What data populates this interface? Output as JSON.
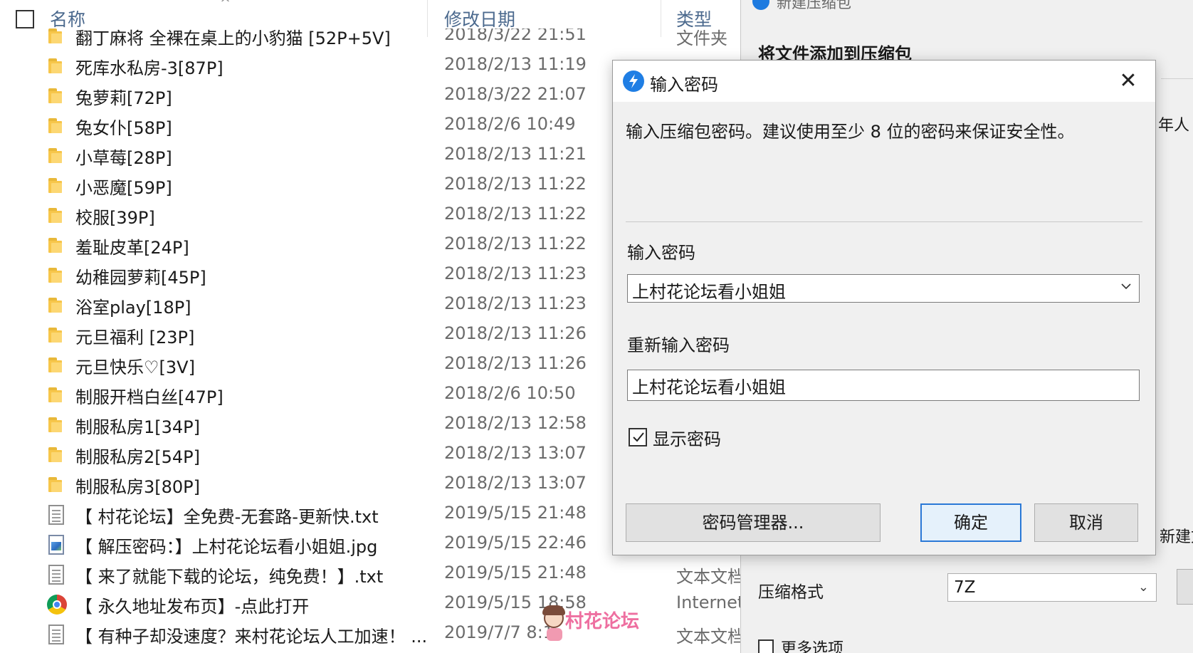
{
  "explorer": {
    "columns": {
      "name": "名称",
      "date": "修改日期",
      "type": "类型"
    },
    "rows": [
      {
        "icon": "folder-icon",
        "name": "翻丁麻将 全裸在桌上的小豹猫 [52P+5V]",
        "date": "2018/3/22 21:51",
        "type": "文件夹"
      },
      {
        "icon": "folder-icon",
        "name": "死库水私房-3[87P]",
        "date": "2018/2/13 11:19",
        "type": ""
      },
      {
        "icon": "folder-icon",
        "name": "兔萝莉[72P]",
        "date": "2018/3/22 21:07",
        "type": ""
      },
      {
        "icon": "folder-icon",
        "name": "兔女仆[58P]",
        "date": "2018/2/6 10:49",
        "type": ""
      },
      {
        "icon": "folder-icon",
        "name": "小草莓[28P]",
        "date": "2018/2/13 11:21",
        "type": ""
      },
      {
        "icon": "folder-icon",
        "name": "小恶魔[59P]",
        "date": "2018/2/13 11:22",
        "type": ""
      },
      {
        "icon": "folder-icon",
        "name": "校服[39P]",
        "date": "2018/2/13 11:22",
        "type": ""
      },
      {
        "icon": "folder-icon",
        "name": "羞耻皮革[24P]",
        "date": "2018/2/13 11:22",
        "type": ""
      },
      {
        "icon": "folder-icon",
        "name": "幼稚园萝莉[45P]",
        "date": "2018/2/13 11:23",
        "type": ""
      },
      {
        "icon": "folder-icon",
        "name": "浴室play[18P]",
        "date": "2018/2/13 11:23",
        "type": ""
      },
      {
        "icon": "folder-icon",
        "name": "元旦福利 [23P]",
        "date": "2018/2/13 11:26",
        "type": ""
      },
      {
        "icon": "folder-icon",
        "name": "元旦快乐♡[3V]",
        "date": "2018/2/13 11:26",
        "type": ""
      },
      {
        "icon": "folder-icon",
        "name": "制服开档白丝[47P]",
        "date": "2018/2/6 10:50",
        "type": ""
      },
      {
        "icon": "folder-icon",
        "name": "制服私房1[34P]",
        "date": "2018/2/13 12:58",
        "type": ""
      },
      {
        "icon": "folder-icon",
        "name": "制服私房2[54P]",
        "date": "2018/2/13 13:07",
        "type": ""
      },
      {
        "icon": "folder-icon",
        "name": "制服私房3[80P]",
        "date": "2018/2/13 13:07",
        "type": ""
      },
      {
        "icon": "text-file-icon",
        "name": "【 村花论坛】全免费-无套路-更新快.txt",
        "date": "2019/5/15 21:48",
        "type": ""
      },
      {
        "icon": "image-file-icon",
        "name": "【 解压密码：】上村花论坛看小姐姐.jpg",
        "date": "2019/5/15 22:46",
        "type": ""
      },
      {
        "icon": "text-file-icon",
        "name": "【 来了就能下载的论坛，纯免费！】.txt",
        "date": "2019/5/15 21:48",
        "type": "文本文档"
      },
      {
        "icon": "chrome-icon",
        "name": "【 永久地址发布页】-点此打开",
        "date": "2019/5/15 18:58",
        "type": "Internet"
      },
      {
        "icon": "text-file-icon",
        "name": "【 有种子却没速度？来村花论坛人工加速！ ...",
        "date": "2019/7/7 8:1",
        "type": "文本文档"
      }
    ]
  },
  "back_dialog": {
    "title": "新建压缩包",
    "heading": "将文件添加到压缩包",
    "peek_text_1": "年人",
    "peek_text_2": "新建文",
    "format_label": "压缩格式",
    "format_value": "7Z",
    "more_options": "更多选项"
  },
  "password_dialog": {
    "title": "输入密码",
    "close": "✕",
    "description": "输入压缩包密码。建议使用至少 8 位的密码来保证安全性。",
    "password_label": "输入密码",
    "password_value": "上村花论坛看小姐姐",
    "confirm_label": "重新输入密码",
    "confirm_value": "上村花论坛看小姐姐",
    "show_password_label": "显示密码",
    "show_password_checked": true,
    "buttons": {
      "manager": "密码管理器...",
      "ok": "确定",
      "cancel": "取消"
    }
  },
  "watermark": {
    "text": "村花论坛"
  },
  "colors": {
    "accent": "#2a78d6",
    "header_text": "#4c6a8e",
    "folder": "#f7c64a",
    "watermark": "#ee6fa0"
  }
}
